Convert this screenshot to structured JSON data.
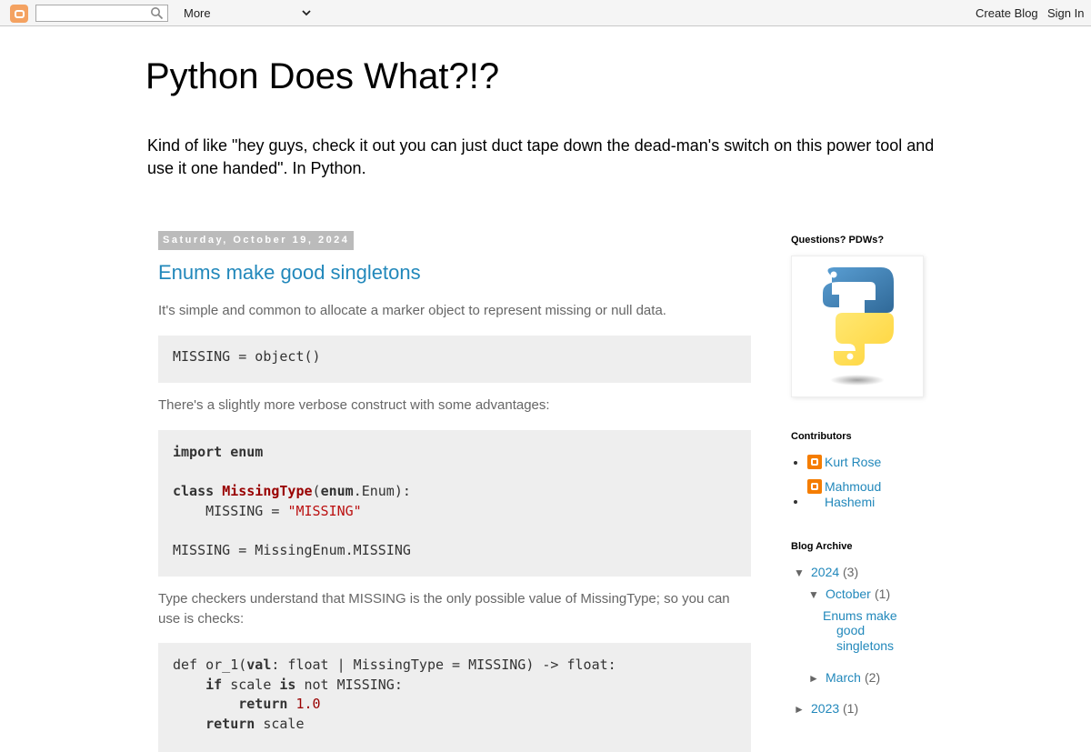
{
  "navbar": {
    "more_label": "More",
    "create_blog": "Create Blog",
    "sign_in": "Sign In",
    "search_placeholder": ""
  },
  "header": {
    "title": "Python Does What?!?",
    "description": "Kind of like \"hey guys, check it out you can just duct tape down the dead-man's switch on this power tool and use it one handed\". In Python."
  },
  "post": {
    "date": "Saturday, October 19, 2024",
    "title": "Enums make good singletons",
    "p1": "It's simple and common to allocate a marker object to represent missing or null data.",
    "code1": "MISSING = object()",
    "p2": "There's a slightly more verbose construct with some advantages:",
    "code2": {
      "l1_kw": "import",
      "l1_mod": "enum",
      "l3_kw": "class",
      "l3_cls": "MissingType",
      "l3_base_mod": "enum",
      "l3_rest": ".Enum):",
      "l4_name": "    MISSING = ",
      "l4_str": "\"MISSING\"",
      "l6": "MISSING = MissingEnum.MISSING"
    },
    "p3": "Type checkers understand that MISSING is the only possible value of MissingType; so you can use is checks:",
    "code3": {
      "l1_pre": "def or_1(",
      "l1_kw": "val",
      "l1_post": ": float | MissingType = MISSING) -> float:",
      "l2_ind": "    ",
      "l2_kw1": "if",
      "l2_mid": " scale ",
      "l2_kw2": "is",
      "l2_post": " not MISSING:",
      "l3_ind": "        ",
      "l3_kw": "return",
      "l3_num": "1.0",
      "l4_ind": "    ",
      "l4_kw": "return",
      "l4_post": " scale"
    }
  },
  "sidebar": {
    "questions_heading": "Questions? PDWs?",
    "contributors_heading": "Contributors",
    "contributors": [
      "Kurt Rose",
      "Mahmoud",
      "Hashemi"
    ],
    "archive_heading": "Blog Archive",
    "archive": {
      "y2024": "2024",
      "y2024_count": "(3)",
      "oct": "October",
      "oct_count": "(1)",
      "post_l1": "Enums make",
      "post_l2": "good",
      "post_l3": "singletons",
      "mar": "March",
      "mar_count": "(2)",
      "y2023": "2023",
      "y2023_count": "(1)",
      "tog_open": "▼",
      "tog_closed": "►"
    }
  },
  "colors": {
    "link": "#2288bb",
    "date_bg": "#bbbbbb",
    "code_bg": "#eeeeee",
    "blogger_orange": "#f57d00"
  }
}
